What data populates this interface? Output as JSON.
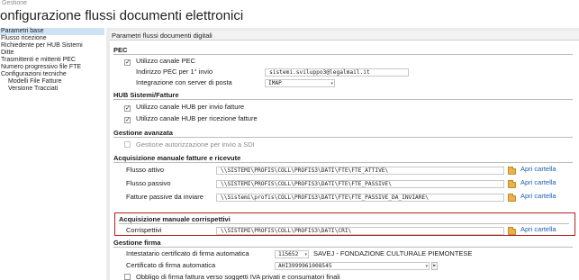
{
  "tab_label": "Gestione",
  "page_title": "onfigurazione flussi documenti elettronici",
  "sidebar": {
    "items": [
      {
        "label": "Parametri base",
        "selected": true,
        "sub": false
      },
      {
        "label": "Flusso ricezione",
        "selected": false,
        "sub": false
      },
      {
        "label": "Richiedente per HUB Sistemi",
        "selected": false,
        "sub": false
      },
      {
        "label": "Ditte",
        "selected": false,
        "sub": false
      },
      {
        "label": "Trasmittenti e mittenti PEC",
        "selected": false,
        "sub": false
      },
      {
        "label": "Numero progressivo file FTE",
        "selected": false,
        "sub": false
      },
      {
        "label": "Configurazioni tecniche",
        "selected": false,
        "sub": false
      },
      {
        "label": "Modelli File Fatture",
        "selected": false,
        "sub": true
      },
      {
        "label": "Versione Tracciati",
        "selected": false,
        "sub": true
      }
    ]
  },
  "panel_title": "Parametri flussi documenti digitali",
  "pec": {
    "section": "PEC",
    "use_channel_label": "Utilizzo canale PEC",
    "use_channel_checked": "✓",
    "address_label": "Indirizzo PEC per 1° invio",
    "address_value": "sistemi.sviluppo3@legalmail.it",
    "mail_server_label": "Integrazione con server di posta",
    "mail_server_value": "IMAP"
  },
  "hub": {
    "section": "HUB Sistemi/Fatture",
    "send_label": "Utilizzo canale HUB per invio fatture",
    "send_checked": "✓",
    "receive_label": "Utilizzo canale HUB per ricezione fatture",
    "receive_checked": "✓"
  },
  "advanced": {
    "section": "Gestione avanzata",
    "sdi_label": "Gestione autorizzazione per invio a SDI"
  },
  "manual": {
    "section": "Acquisizione manuale fatture e ricevute",
    "active_label": "Flusso attivo",
    "active_path": "\\\\SISTEMI\\PROFIS\\COLL\\PROFIS3\\DATI\\FTE\\FTE_ATTIVE\\",
    "passive_label": "Flusso passivo",
    "passive_path": "\\\\SISTEMI\\PROFIS\\COLL\\PROFIS3\\DATI\\FTE\\FTE_PASSIVE\\",
    "to_send_label": "Fatture passive da inviare",
    "to_send_path": "\\\\Sistemi\\profis\\COLL\\PROFIS3\\DATI\\FTE\\FTE_PASSIVE_DA_INVIARE\\",
    "open_folder": "Apri cartella"
  },
  "receipts": {
    "section": "Acquisizione manuale corrispettivi",
    "label": "Corrispettivi",
    "path": "\\\\SISTEMI\\PROFIS\\COLL\\PROFIS3\\DATI\\CRI\\",
    "open_folder": "Apri cartella"
  },
  "signature": {
    "section": "Gestione firma",
    "holder_label": "Intestatario certificato di firma automatica",
    "holder_code": "115652",
    "holder_name": "SAVEJ - FONDAZIONE CULTURALE PIEMONTESE",
    "cert_label": "Certificato di firma automatica",
    "cert_value": "AHI3999961008545",
    "mandatory_label": "Obbligo di firma fattura verso soggetti IVA privati e consumatori finali"
  },
  "icons": {
    "dropdown": "▾",
    "stepper_right": "▸"
  },
  "colors": {
    "highlight_border": "#b22222",
    "link": "#1a5fb4",
    "selection": "#cde2f5"
  }
}
